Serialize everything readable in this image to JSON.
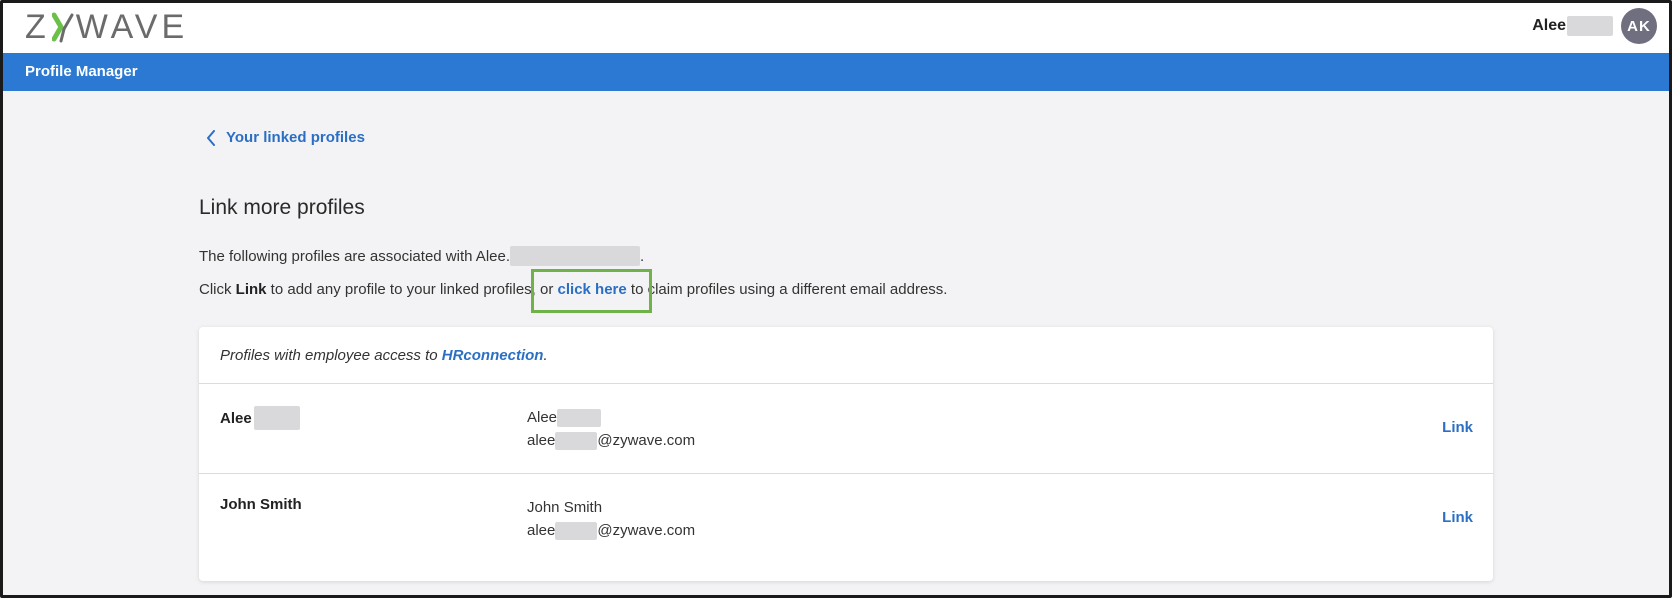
{
  "header": {
    "logo_text_left": "Z",
    "logo_text_right": "WAVE",
    "user_name": "Alee",
    "avatar_initials": "AK"
  },
  "nav": {
    "title": "Profile Manager"
  },
  "back_link": {
    "label": "Your linked profiles"
  },
  "main": {
    "title": "Link more profiles",
    "desc1_prefix": "The following profiles are associated with Alee.",
    "desc1_suffix": ".",
    "desc2_part1": "Click ",
    "desc2_bold": "Link",
    "desc2_part2": " to add any profile to your linked profiles, or ",
    "desc2_link": "click here",
    "desc2_part3": " to claim profiles using a different email address."
  },
  "card": {
    "header_prefix": "Profiles with employee access to ",
    "header_link": "HRconnection",
    "header_suffix": ".",
    "rows": [
      {
        "name": "Alee",
        "detail_name": "Alee",
        "email_prefix": "alee",
        "email_suffix": "@zywave.com",
        "action": "Link"
      },
      {
        "name": "John Smith",
        "detail_name": "John Smith",
        "email_prefix": "alee",
        "email_suffix": "@zywave.com",
        "action": "Link"
      }
    ]
  },
  "colors": {
    "brand_blue": "#2b79d3",
    "link_blue": "#2b6fc4",
    "highlight_green": "#6fb24a",
    "logo_green": "#6cc04a"
  }
}
